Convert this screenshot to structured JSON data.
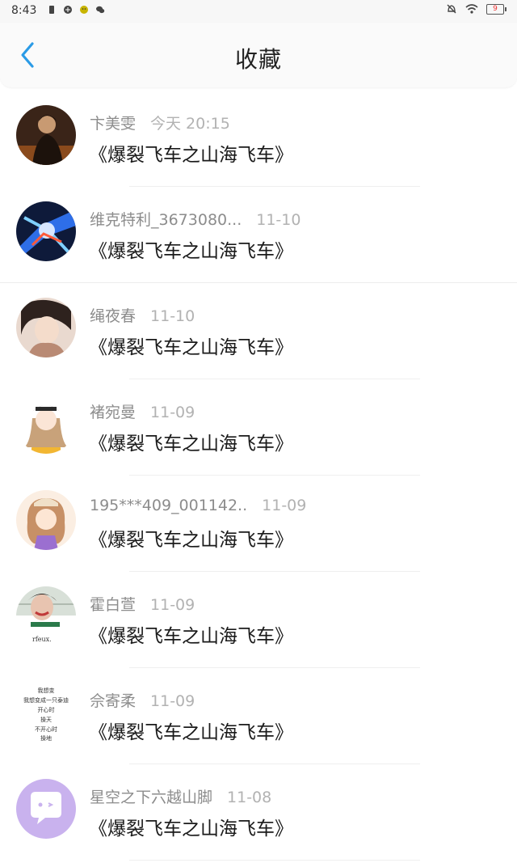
{
  "status_bar": {
    "time": "8:43",
    "battery": "9"
  },
  "header": {
    "title": "收藏",
    "back_icon": "chevron-left-icon",
    "accent": "#2b9be6"
  },
  "favorites": [
    {
      "user": "卞美雯",
      "date": "今天 20:15",
      "title": "《爆裂飞车之山海飞车》"
    },
    {
      "user": "维克特利_3673080...",
      "date": "11-10",
      "title": "《爆裂飞车之山海飞车》"
    },
    {
      "user": "绳夜春",
      "date": "11-10",
      "title": "《爆裂飞车之山海飞车》"
    },
    {
      "user": "褚宛曼",
      "date": "11-09",
      "title": "《爆裂飞车之山海飞车》"
    },
    {
      "user": "195***409_001142..",
      "date": "11-09",
      "title": "《爆裂飞车之山海飞车》"
    },
    {
      "user": "霍白萱",
      "date": "11-09",
      "title": "《爆裂飞车之山海飞车》"
    },
    {
      "user": "佘寄柔",
      "date": "11-09",
      "title": "《爆裂飞车之山海飞车》",
      "avatar_text": [
        "我想变",
        "我想变成一只泰迪",
        "开心时",
        "操天",
        "不开心时",
        "操地"
      ]
    },
    {
      "user": "星空之下六越山脚",
      "date": "11-08",
      "title": "《爆裂飞车之山海飞车》"
    }
  ]
}
